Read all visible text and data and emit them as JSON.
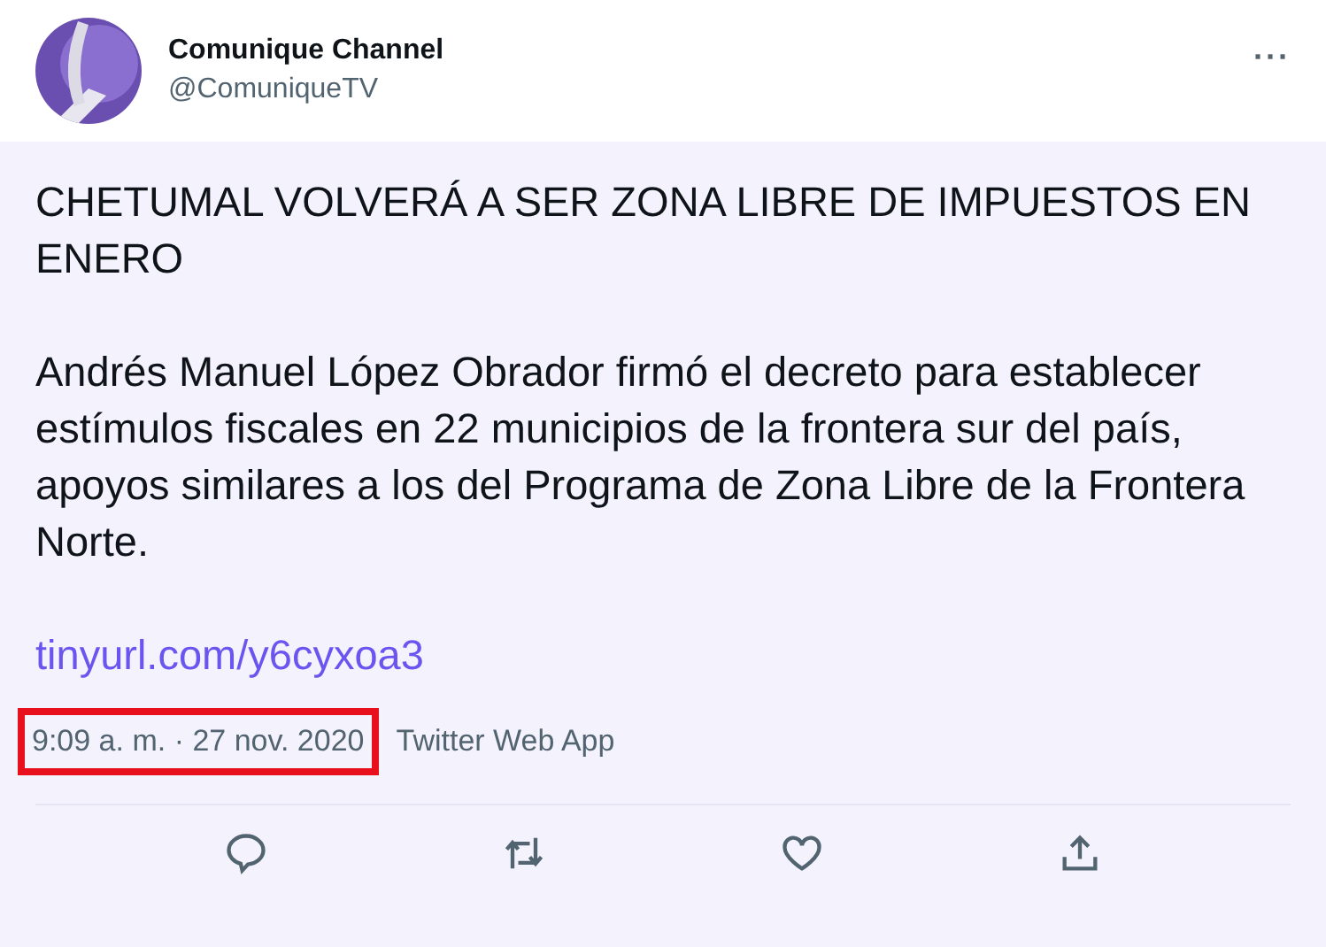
{
  "author": {
    "name": "Comunique Channel",
    "handle": "@ComuniqueTV"
  },
  "menu": "···",
  "tweet": {
    "headline": "CHETUMAL VOLVERÁ A SER ZONA LIBRE DE IMPUESTOS EN ENERO",
    "paragraph": "Andrés Manuel López Obrador firmó el decreto para establecer estímulos fiscales en 22 municipios de la frontera sur del país, apoyos similares a los del Programa de Zona Libre de la Frontera Norte.",
    "link": "tinyurl.com/y6cyxoa3"
  },
  "meta": {
    "timestamp": "9:09 a. m. · 27 nov. 2020",
    "timestamp_highlighted": true,
    "source": "Twitter Web App"
  },
  "actions": [
    {
      "kind": "reply"
    },
    {
      "kind": "retweet"
    },
    {
      "kind": "like"
    },
    {
      "kind": "share"
    }
  ]
}
